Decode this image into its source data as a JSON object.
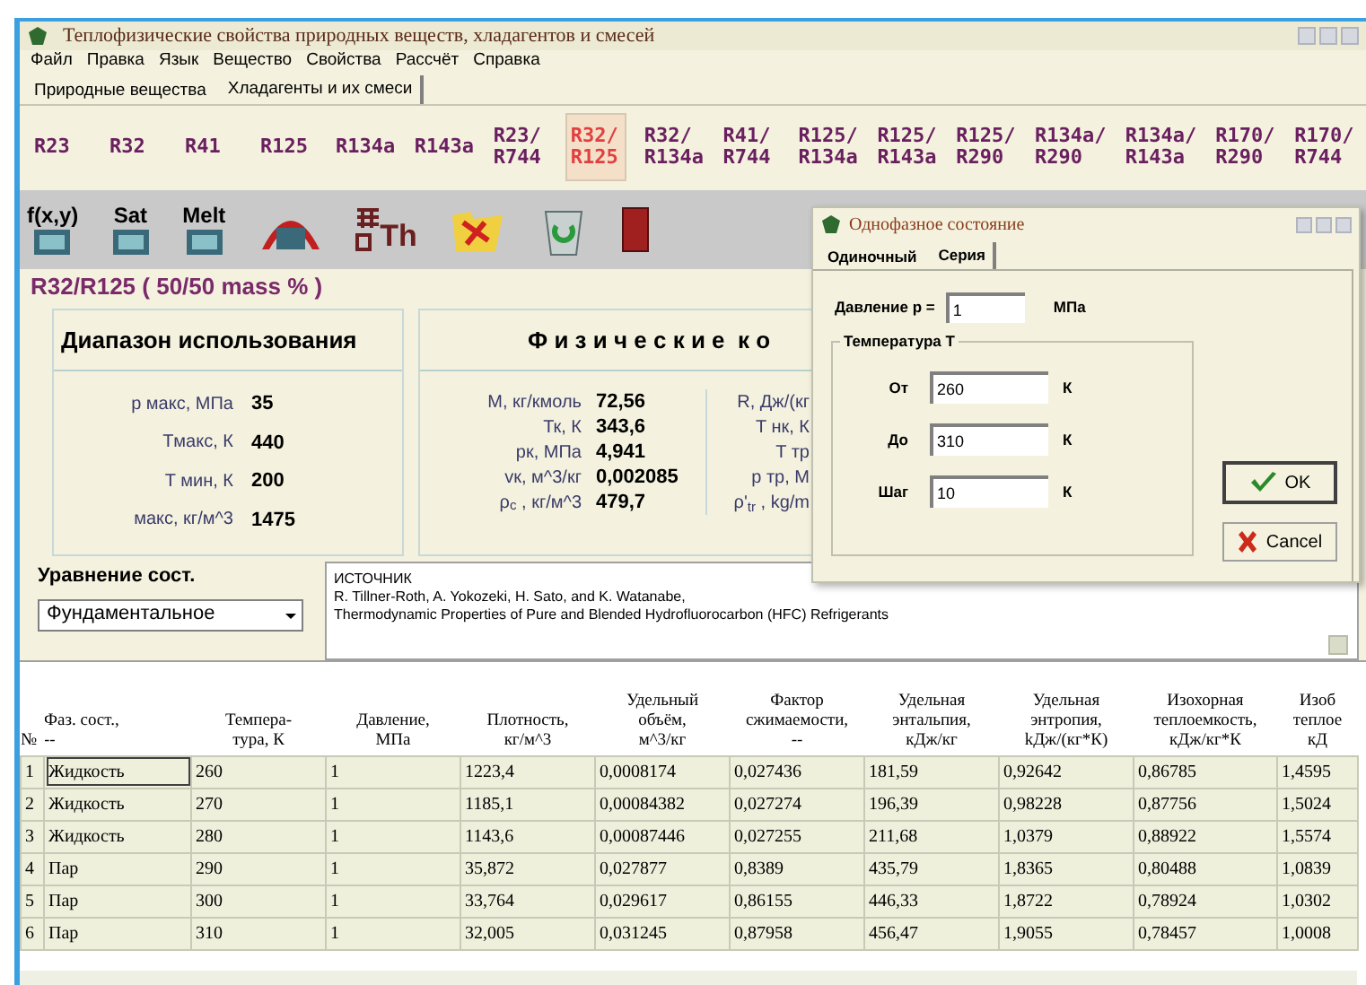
{
  "window": {
    "title": "Теплофизические свойства природных веществ, хладагентов и смесей"
  },
  "menu": [
    "Файл",
    "Правка",
    "Язык",
    "Вещество",
    "Свойства",
    "Рассчёт",
    "Справка"
  ],
  "tabs": [
    {
      "label": "Природные вещества",
      "selected": false
    },
    {
      "label": "Хладагенты и их смеси",
      "selected": true
    }
  ],
  "refrigerants": [
    {
      "label": "R23",
      "selected": false
    },
    {
      "label": "R32",
      "selected": false
    },
    {
      "label": "R41",
      "selected": false
    },
    {
      "label": "R125",
      "selected": false
    },
    {
      "label": "R134a",
      "selected": false
    },
    {
      "label": "R143a",
      "selected": false
    },
    {
      "label": "R23/\nR744",
      "selected": false
    },
    {
      "label": "R32/\nR125",
      "selected": true
    },
    {
      "label": "R32/\nR134a",
      "selected": false
    },
    {
      "label": "R41/\nR744",
      "selected": false
    },
    {
      "label": "R125/\nR134a",
      "selected": false
    },
    {
      "label": "R125/\nR143a",
      "selected": false
    },
    {
      "label": "R125/\nR290",
      "selected": false
    },
    {
      "label": "R134a/\nR290",
      "selected": false
    },
    {
      "label": "R134a/\nR143a",
      "selected": false
    },
    {
      "label": "R170/\nR290",
      "selected": false
    },
    {
      "label": "R170/\nR744",
      "selected": false
    }
  ],
  "toolbar": [
    {
      "kind": "calc",
      "label": "f(x,y)"
    },
    {
      "kind": "calc",
      "label": "Sat"
    },
    {
      "kind": "calc",
      "label": "Melt"
    },
    {
      "kind": "dome"
    },
    {
      "kind": "grid",
      "label": "Th"
    },
    {
      "kind": "folder"
    },
    {
      "kind": "bin"
    },
    {
      "kind": "door"
    }
  ],
  "substance": "R32/R125 ( 50/50 mass % )",
  "range": {
    "title": "Диапазон использования",
    "rows": [
      {
        "label": "р макс, МПа",
        "value": "35"
      },
      {
        "label": "Tмакс, К",
        "value": "440"
      },
      {
        "label": "T мин,  К",
        "value": "200"
      },
      {
        "label": "макс, кг/м^3",
        "value": "1475"
      }
    ]
  },
  "constants": {
    "title": "Ф и з и ч е с к и е  к о",
    "rows": [
      {
        "label": "M, кг/кмоль",
        "value": "72,56"
      },
      {
        "label": "Тк, К",
        "value": "343,6"
      },
      {
        "label": "рк, МПа",
        "value": "4,941"
      },
      {
        "label": "vк, м^3/кг",
        "value": "0,002085"
      },
      {
        "label": "ρ$_{c}$ , кг/м^3",
        "value": "479,7"
      }
    ],
    "column_2_labels": [
      "R, Дж/(кг",
      "T нк, К",
      "T тр",
      "р тр, М",
      "ρ'$_{tr}$ , kg/m"
    ]
  },
  "equation": {
    "label": "Уравнение сост.",
    "value": "Фундаментальное"
  },
  "source": {
    "heading": "ИСТОЧНИК",
    "lines": [
      "R. Tillner-Roth, A. Yokozeki, H. Sato, and K. Watanabe,",
      "Thermodynamic Properties of Pure and Blended Hydrofluorocarbon (HFC) Refrigerants"
    ]
  },
  "table": {
    "columns": [
      "№",
      "Фаз. сост.,\n--",
      "Темпера-\nтура, К",
      "Давление,\nМПа",
      "Плотность,\nкг/м^3",
      "Удельный\nобъём,\nм^3/кг",
      "Фактор\nсжимаемости,\n--",
      "Удельная\nэнтальпия,\nкДж/кг",
      "Удельная\nэнтропия,\nkДж/(кг*К)",
      "Изохорная\nтеплоемкость,\nкДж/кг*К",
      "Изоб\nтеплое\nкД"
    ],
    "rows": [
      {
        "focused": true,
        "cells": [
          "1",
          "Жидкость",
          "260",
          "1",
          "1223,4",
          "0,0008174",
          "0,027436",
          "181,59",
          "0,92642",
          "0,86785",
          "1,4595"
        ]
      },
      {
        "focused": false,
        "cells": [
          "2",
          "Жидкость",
          "270",
          "1",
          "1185,1",
          "0,00084382",
          "0,027274",
          "196,39",
          "0,98228",
          "0,87756",
          "1,5024"
        ]
      },
      {
        "focused": false,
        "cells": [
          "3",
          "Жидкость",
          "280",
          "1",
          "1143,6",
          "0,00087446",
          "0,027255",
          "211,68",
          "1,0379",
          "0,88922",
          "1,5574"
        ]
      },
      {
        "focused": false,
        "cells": [
          "4",
          "Пар",
          "290",
          "1",
          "35,872",
          "0,027877",
          "0,8389",
          "435,79",
          "1,8365",
          "0,80488",
          "1,0839"
        ]
      },
      {
        "focused": false,
        "cells": [
          "5",
          "Пар",
          "300",
          "1",
          "33,764",
          "0,029617",
          "0,86155",
          "446,33",
          "1,8722",
          "0,78924",
          "1,0302"
        ]
      },
      {
        "focused": false,
        "cells": [
          "6",
          "Пар",
          "310",
          "1",
          "32,005",
          "0,031245",
          "0,87958",
          "456,47",
          "1,9055",
          "0,78457",
          "1,0008"
        ]
      }
    ]
  },
  "dialog": {
    "title": "Однофазное состояние",
    "tabs": [
      {
        "label": "Одиночный",
        "selected": false
      },
      {
        "label": "Серия",
        "selected": true
      }
    ],
    "pressure": {
      "label": "Давление р =",
      "value": "1",
      "unit": "МПа"
    },
    "group": "Температура Т",
    "fields": [
      {
        "label": "От",
        "value": "260",
        "unit": "К"
      },
      {
        "label": "До",
        "value": "310",
        "unit": "К"
      },
      {
        "label": "Шаг",
        "value": "10",
        "unit": "К"
      }
    ],
    "ok": "OK",
    "cancel": "Cancel"
  }
}
